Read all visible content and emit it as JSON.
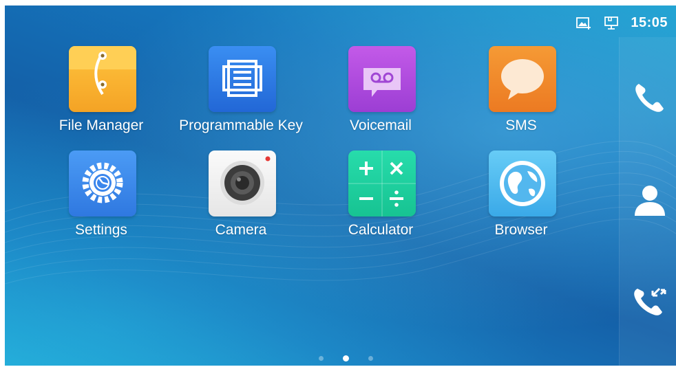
{
  "status_bar": {
    "time": "15:05",
    "icons": [
      "screenshot-icon",
      "network-icon"
    ]
  },
  "apps": [
    {
      "label": "File Manager",
      "icon": "file-manager-icon",
      "color": "#f8b634"
    },
    {
      "label": "Programmable Key",
      "icon": "programmable-key-icon",
      "color": "#2f7fe8"
    },
    {
      "label": "Voicemail",
      "icon": "voicemail-icon",
      "color": "#b64de3"
    },
    {
      "label": "SMS",
      "icon": "sms-icon",
      "color": "#f38a2b"
    },
    {
      "label": "Settings",
      "icon": "settings-icon",
      "color": "#3b8cf0"
    },
    {
      "label": "Camera",
      "icon": "camera-icon",
      "color": "#f2f2f2"
    },
    {
      "label": "Calculator",
      "icon": "calculator-icon",
      "color": "#1fd3a0"
    },
    {
      "label": "Browser",
      "icon": "browser-icon",
      "color": "#55c0f0"
    }
  ],
  "side_buttons": [
    "phone-icon",
    "contacts-icon",
    "call-history-icon"
  ],
  "pager": {
    "pages": 3,
    "active": 2
  }
}
